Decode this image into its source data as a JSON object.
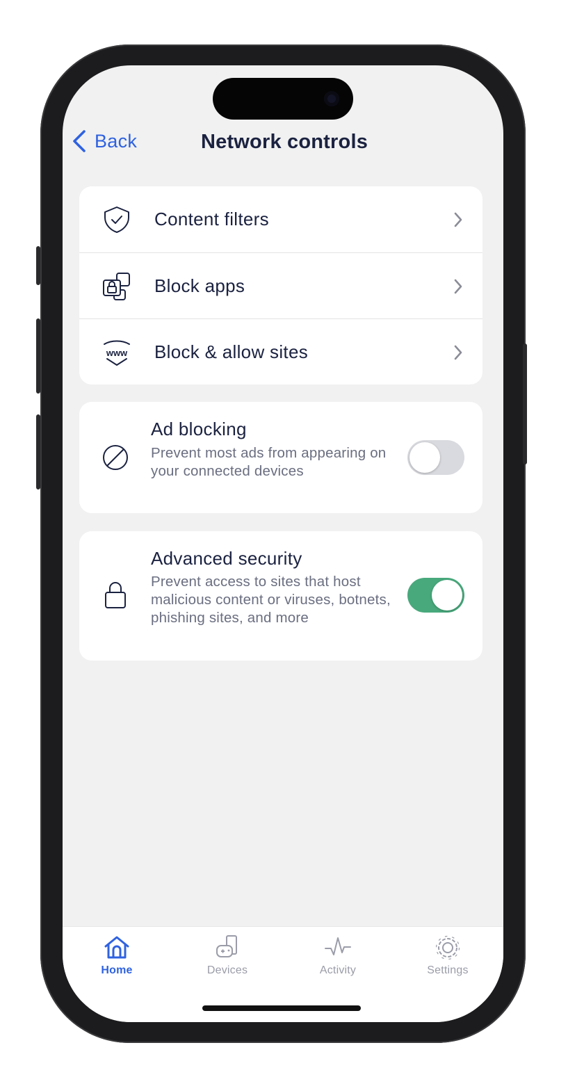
{
  "nav": {
    "back_label": "Back",
    "title": "Network controls"
  },
  "menu": [
    {
      "icon": "shield-check-icon",
      "label": "Content filters"
    },
    {
      "icon": "app-lock-icon",
      "label": "Block apps"
    },
    {
      "icon": "www-shield-icon",
      "label": "Block & allow sites"
    }
  ],
  "ad_blocking": {
    "icon": "prohibit-icon",
    "title": "Ad blocking",
    "description": "Prevent most ads from appearing on your connected devices",
    "enabled": false
  },
  "advanced_security": {
    "icon": "lock-icon",
    "title": "Advanced security",
    "description": "Prevent access to sites that host malicious content or viruses, botnets, phishing sites, and more",
    "enabled": true
  },
  "tabs": [
    {
      "icon": "home-icon",
      "label": "Home",
      "active": true
    },
    {
      "icon": "devices-icon",
      "label": "Devices",
      "active": false
    },
    {
      "icon": "activity-icon",
      "label": "Activity",
      "active": false
    },
    {
      "icon": "gear-icon",
      "label": "Settings",
      "active": false
    }
  ],
  "colors": {
    "accent": "#2f62e0",
    "toggle_on": "#48a97c",
    "text": "#1b2240",
    "muted": "#6a6e80"
  }
}
